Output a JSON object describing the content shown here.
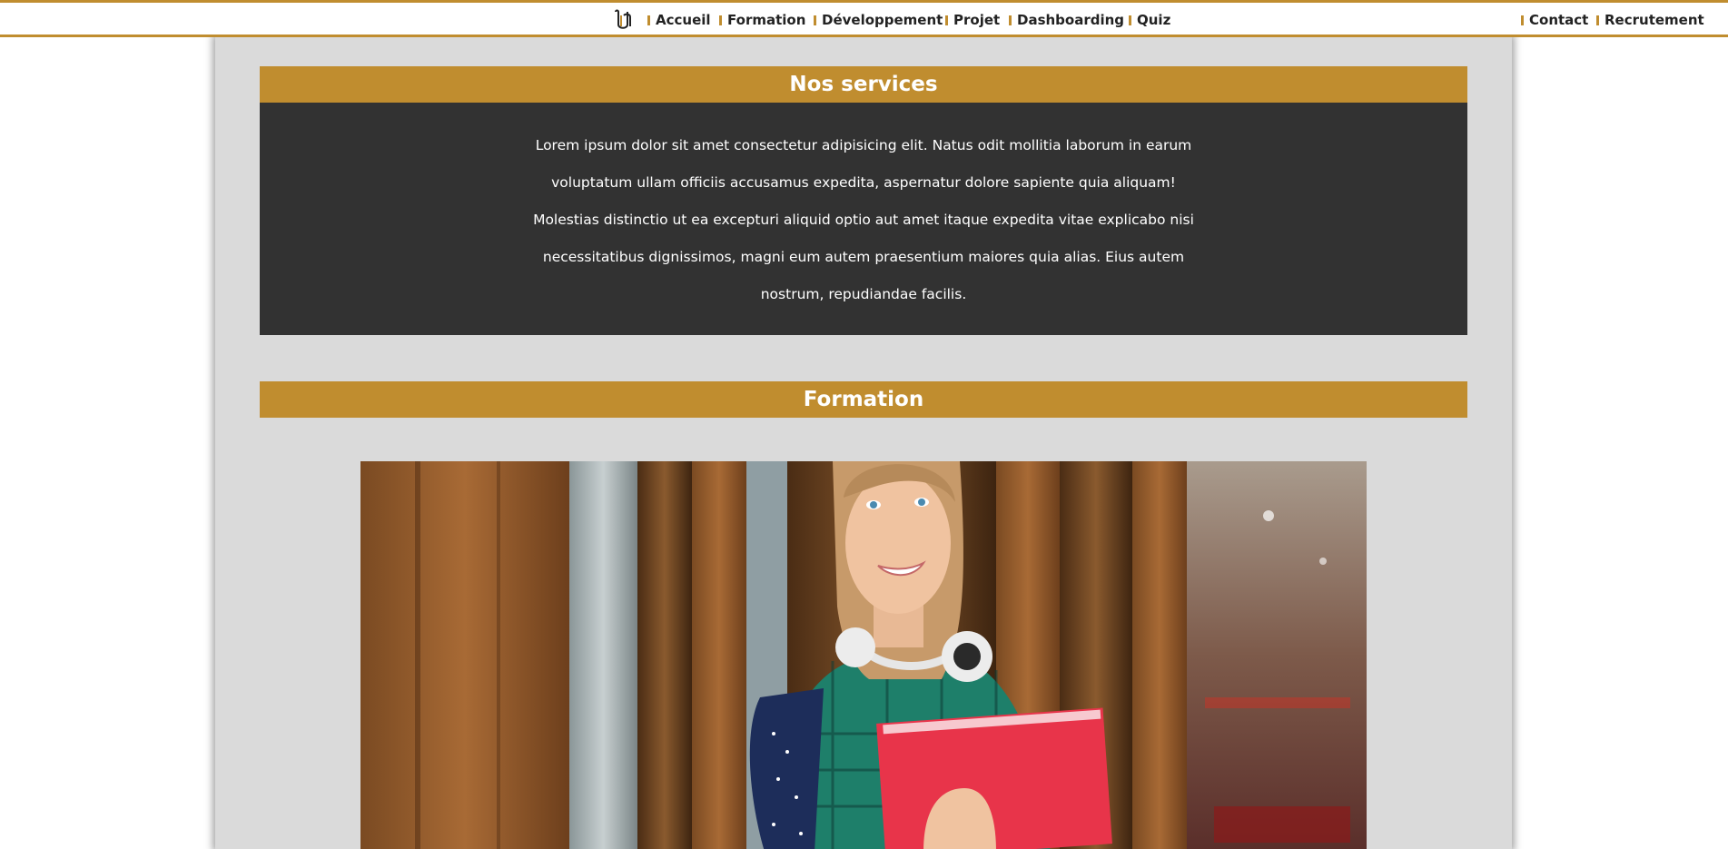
{
  "nav": {
    "logo_icon": "logo-icon",
    "links": [
      {
        "label": "Accueil"
      },
      {
        "label": "Formation"
      },
      {
        "label": "Développement"
      },
      {
        "label": "Projet"
      },
      {
        "label": "Dashboarding"
      },
      {
        "label": "Quiz"
      }
    ],
    "right_links": [
      {
        "label": "Contact"
      },
      {
        "label": "Recrutement"
      }
    ]
  },
  "services": {
    "title": "Nos services",
    "text": "Lorem ipsum dolor sit amet consectetur adipisicing elit. Natus odit mollitia laborum in earum voluptatum ullam officiis accusamus expedita, aspernatur dolore sapiente quia aliquam! Molestias distinctio ut ea excepturi aliquid optio aut amet itaque expedita vitae explicabo nisi necessitatibus dignissimos, magni eum autem praesentium maiores quia alias. Eius autem nostrum, repudiandae facilis."
  },
  "formation": {
    "title": "Formation"
  },
  "colors": {
    "accent": "#c08d2f",
    "dark_panel": "#323232",
    "page_bg": "#dadada"
  }
}
